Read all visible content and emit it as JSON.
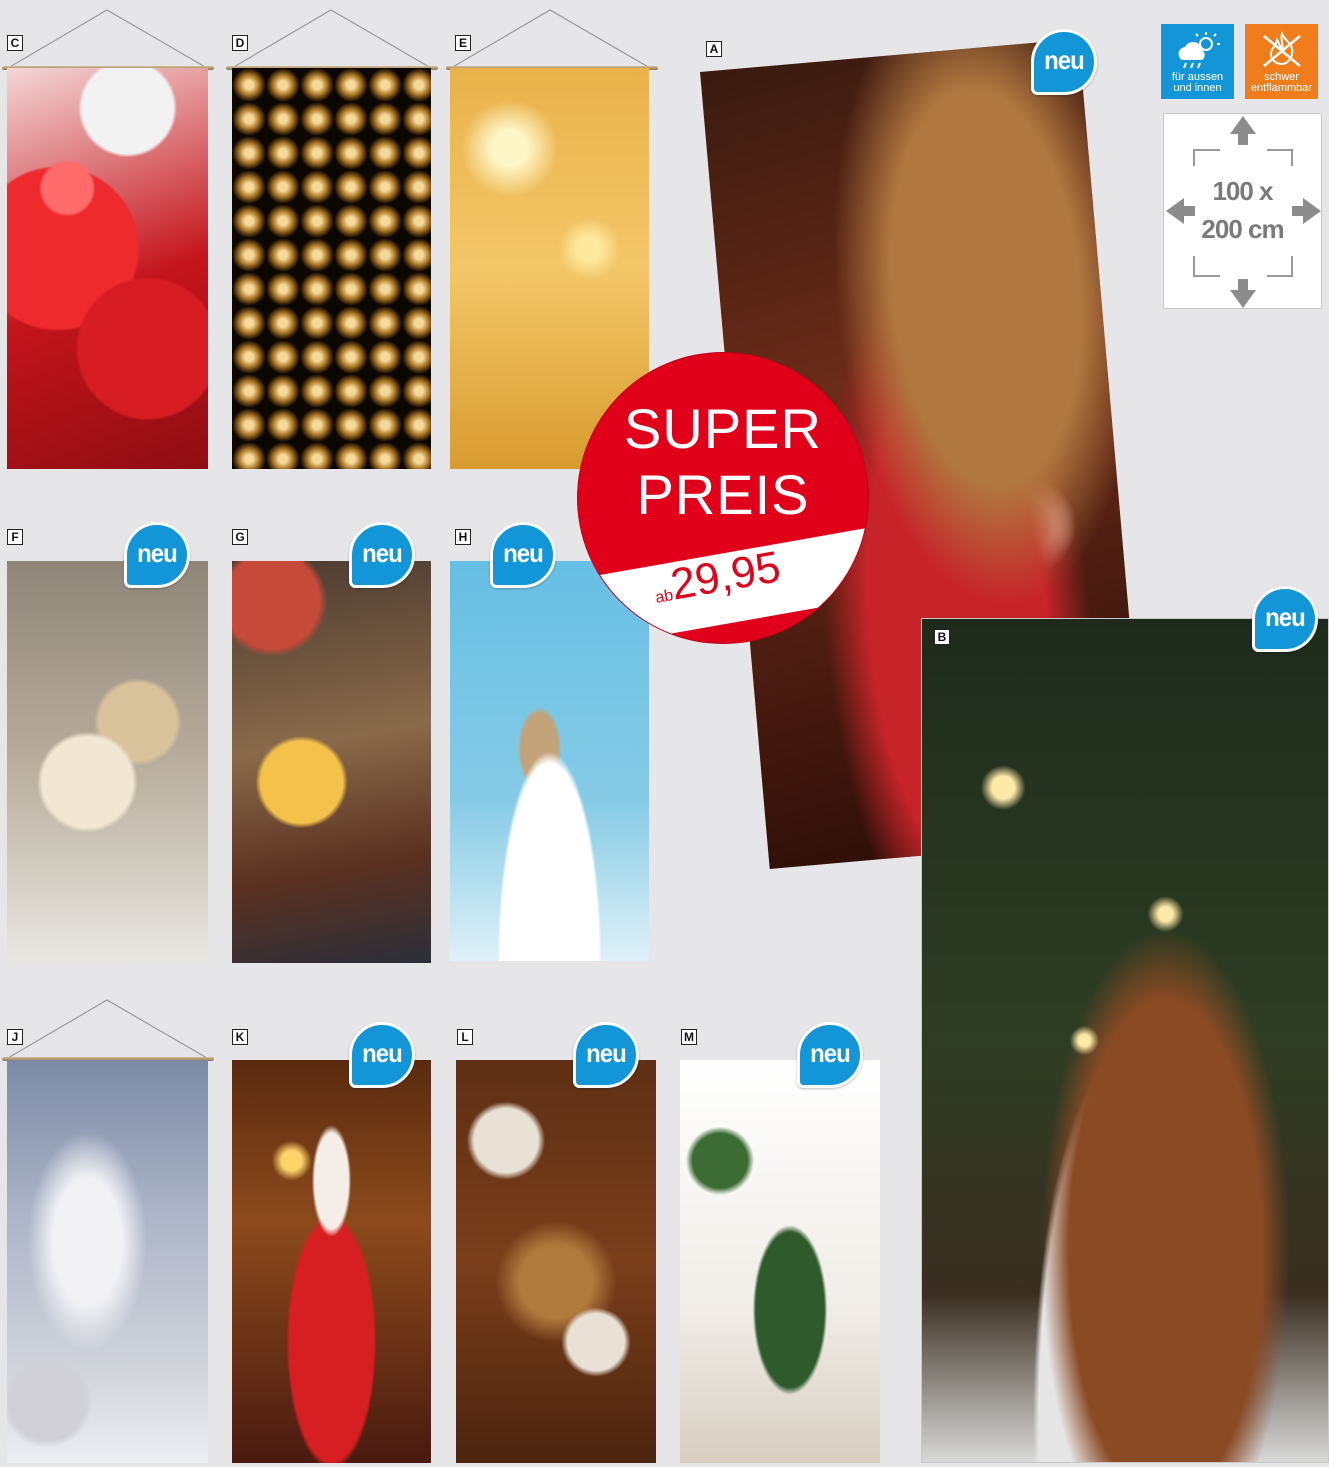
{
  "badge_text": "neu",
  "super_price": {
    "line1": "SUPER",
    "line2": "PREIS",
    "prefix": "ab",
    "price": "29,95"
  },
  "icons": {
    "outdoor": {
      "line1": "für aussen",
      "line2": "und innen",
      "color": "#1296d8",
      "icon": "sun-cloud-rain-icon"
    },
    "flame": {
      "line1": "schwer",
      "line2": "entflammbar",
      "color": "#f07d1b",
      "icon": "flame-icon"
    }
  },
  "size": {
    "line1": "100 x",
    "line2": "200 cm"
  },
  "products": {
    "A": {
      "letter": "A",
      "badge": true
    },
    "B": {
      "letter": "B",
      "badge": true
    },
    "C": {
      "letter": "C",
      "badge": false
    },
    "D": {
      "letter": "D",
      "badge": false
    },
    "E": {
      "letter": "E",
      "badge": false
    },
    "F": {
      "letter": "F",
      "badge": true
    },
    "G": {
      "letter": "G",
      "badge": true
    },
    "H": {
      "letter": "H",
      "badge": true
    },
    "J": {
      "letter": "J",
      "badge": false
    },
    "K": {
      "letter": "K",
      "badge": true
    },
    "L": {
      "letter": "L",
      "badge": true
    },
    "M": {
      "letter": "M",
      "badge": true
    }
  },
  "colors": {
    "background": "#e6e6e9",
    "sale_red": "#e1001a",
    "badge_blue": "#1296d8"
  }
}
